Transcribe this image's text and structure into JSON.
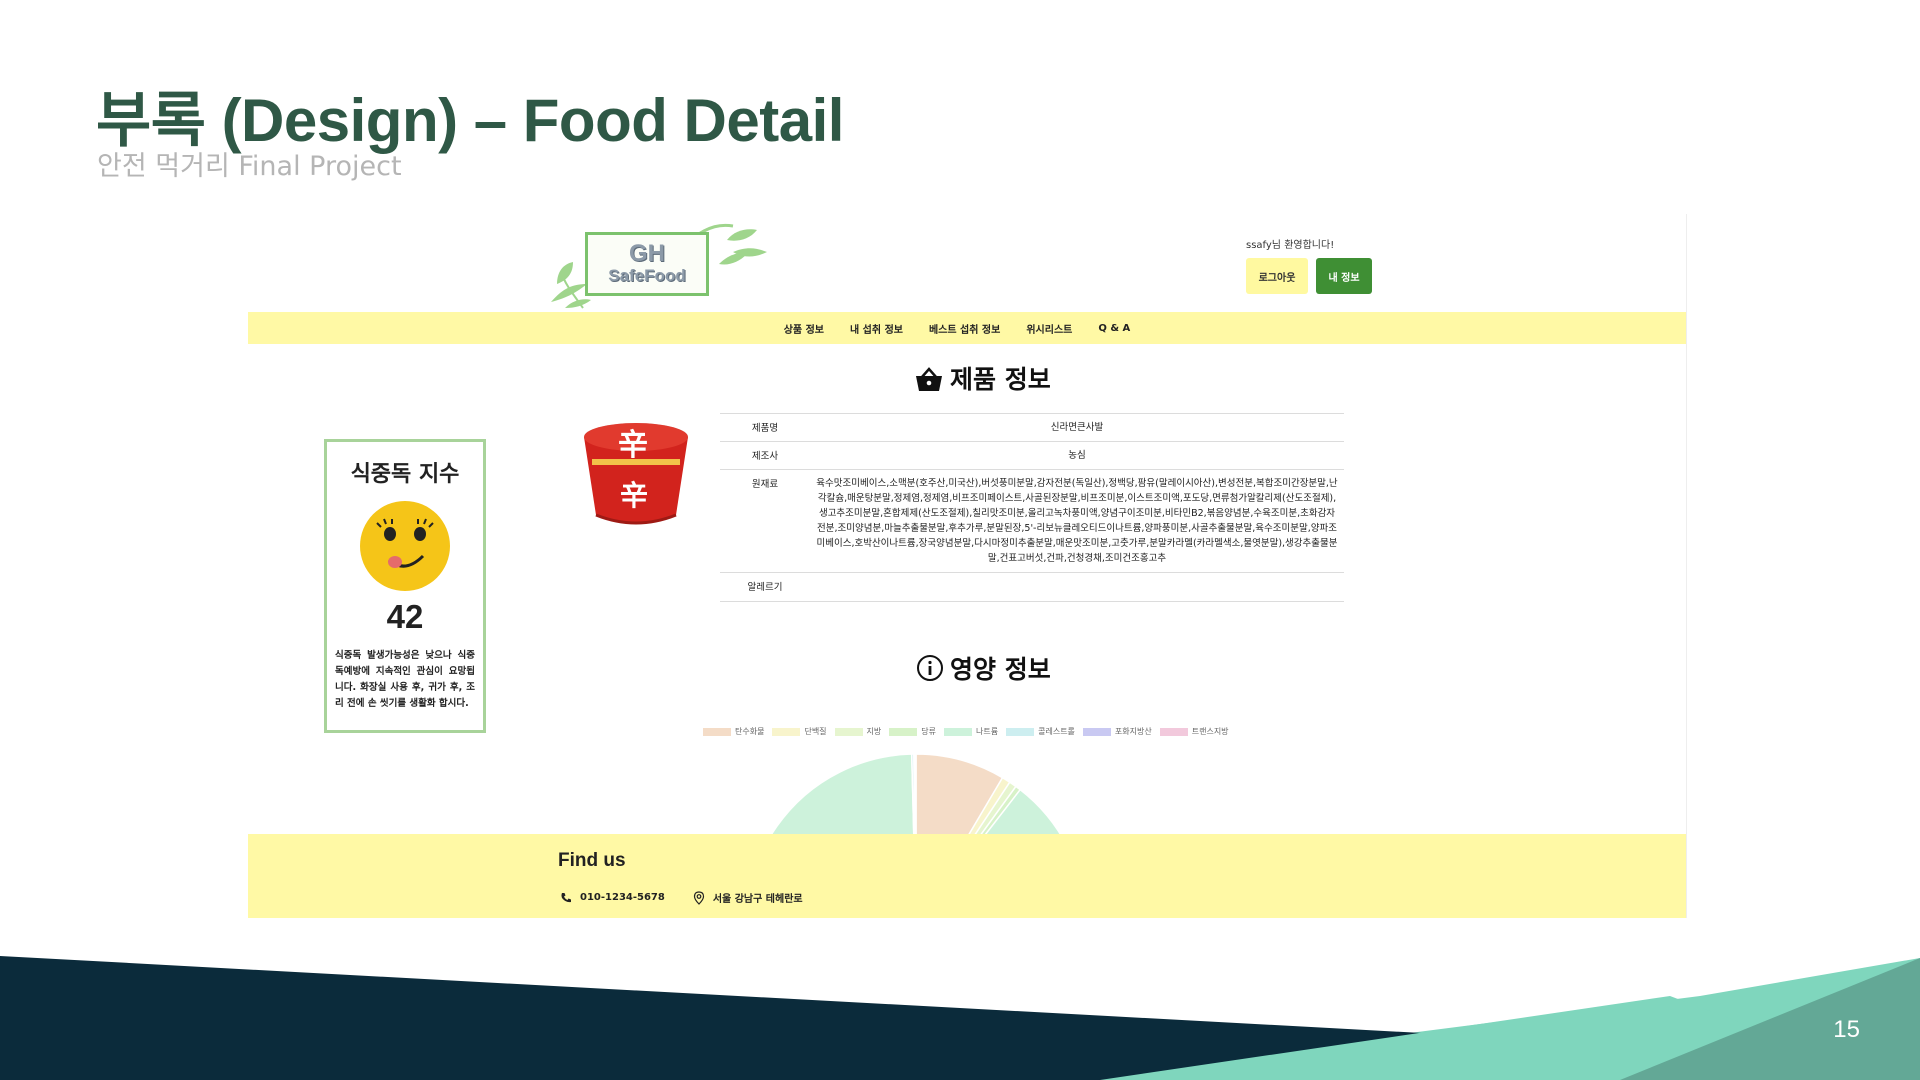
{
  "slide": {
    "title": "부록 (Design) – Food Detail",
    "subtitle": "안전 먹거리 Final Project",
    "page_number": "15"
  },
  "web": {
    "logo": {
      "line1": "GH",
      "line2": "SafeFood",
      "icon": "leaf-logo-icon"
    },
    "user": {
      "welcome": "ssafy님 환영합니다!",
      "logout_label": "로그아웃",
      "myinfo_label": "내 정보"
    },
    "nav": {
      "items": [
        "상품 정보",
        "내 섭취 정보",
        "베스트 섭취 정보",
        "위시리스트",
        "Q & A"
      ]
    },
    "product_section": {
      "title": "제품 정보",
      "icon": "basket-icon"
    },
    "food_poisoning": {
      "title": "식중독 지수",
      "value": "42",
      "description": "식중독 발생가능성은 낮으나 식중독예방에 지속적인 관심이 요망됩니다. 화장실 사용 후, 귀가 후, 조리 전에 손 씻기를 생활화 합시다.",
      "icon": "smiley-face-icon"
    },
    "product_image": {
      "icon": "ramen-cup-image"
    },
    "product_info": {
      "name_label": "제품명",
      "name_value": "신라면큰사발",
      "maker_label": "제조사",
      "maker_value": "농심",
      "ingredients_label": "원재료",
      "ingredients_value": "육수맛조미베이스,소맥분(호주산,미국산),버섯풍미분말,감자전분(독일산),정백당,팜유(말레이시아산),변성전분,복합조미간장분말,난각칼슘,매운탕분말,정제염,정제염,비프조미페이스트,사골된장분말,비프조미분,이스트조미액,포도당,면류첨가알칼리제(산도조절제),생고추조미분말,혼합제제(산도조절제),칠리맛조미분,올리고녹차풍미액,양념구이조미분,비타민B2,볶음양념분,수육조미분,초화감자전분,조미양념분,마늘추출물분말,후추가루,분말된장,5'-리보뉴클레오티드이나트륨,양파풍미분,사골추출물분말,육수조미분말,양파조미베이스,호박산이나트륨,장국양념분말,다시마정미추출분말,매운맛조미분,고춧가루,분말카라멜(카라멜색소,물엿분말),생강추출물분말,건표고버섯,건파,건청경채,조미건조홍고추",
      "allergy_label": "알레르기",
      "allergy_value": ""
    },
    "nutrition_section": {
      "title": "영양 정보",
      "icon": "info-circle-icon"
    },
    "footer": {
      "title": "Find us",
      "phone": "010-1234-5678",
      "address": "서울 강남구 테헤란로",
      "phone_icon": "phone-icon",
      "address_icon": "map-pin-icon"
    }
  },
  "chart_data": {
    "type": "pie",
    "series_labels": [
      "탄수화물",
      "단백질",
      "지방",
      "당류",
      "나트륨",
      "콜레스트롤",
      "포화지방산",
      "트랜스지방"
    ],
    "colors": [
      "#f4dcc7",
      "#f8f4cc",
      "#e6f5cf",
      "#d7f2c8",
      "#cdf2db",
      "#cdeef0",
      "#c9c9f2",
      "#f2c9dc"
    ],
    "values": [
      8.5,
      0.8,
      0.7,
      0.5,
      89.1,
      0.2,
      0.1,
      0.1
    ],
    "visible_portion": "top-of-pie-cropped",
    "legend_position": "top"
  }
}
